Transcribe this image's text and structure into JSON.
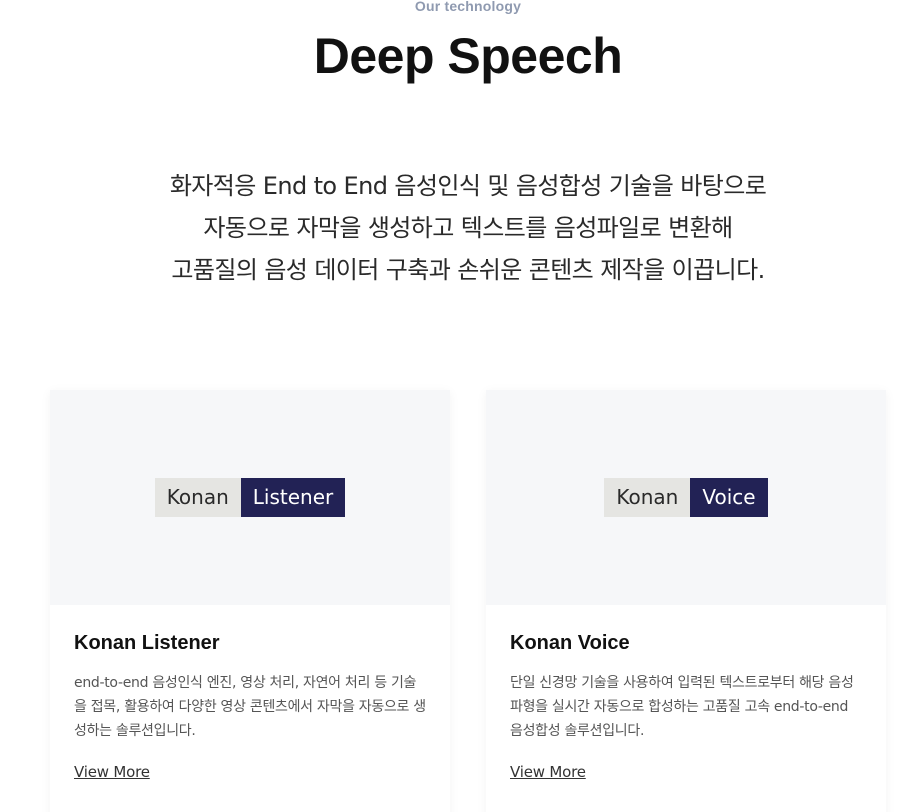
{
  "header": {
    "eyebrow": "Our technology",
    "title": "Deep Speech"
  },
  "description": {
    "line1": "화자적응 End to End 음성인식 및 음성합성 기술을 바탕으로",
    "line2": "자동으로 자막을 생성하고 텍스트를 음성파일로 변환해",
    "line3": "고품질의 음성 데이터 구축과 손쉬운 콘텐츠 제작을 이끕니다."
  },
  "cards": [
    {
      "logo_part1": "Konan",
      "logo_part2": "Listener",
      "title": "Konan Listener",
      "text": "end-to-end 음성인식 엔진, 영상 처리, 자연어 처리 등 기술을 접목, 활용하여 다양한 영상 콘텐츠에서 자막을 자동으로 생성하는 솔루션입니다.",
      "link": "View More"
    },
    {
      "logo_part1": "Konan",
      "logo_part2": "Voice",
      "title": "Konan Voice",
      "text": "단일 신경망 기술을 사용하여 입력된 텍스트로부터 해당 음성파형을 실시간 자동으로 합성하는 고품질 고속 end-to-end 음성합성 솔루션입니다.",
      "link": "View More"
    }
  ],
  "colors": {
    "eyebrow": "#8f9ab0",
    "logo_dark": "#222255",
    "logo_light": "#e5e5e2",
    "card_media_bg": "#f6f7f9"
  }
}
